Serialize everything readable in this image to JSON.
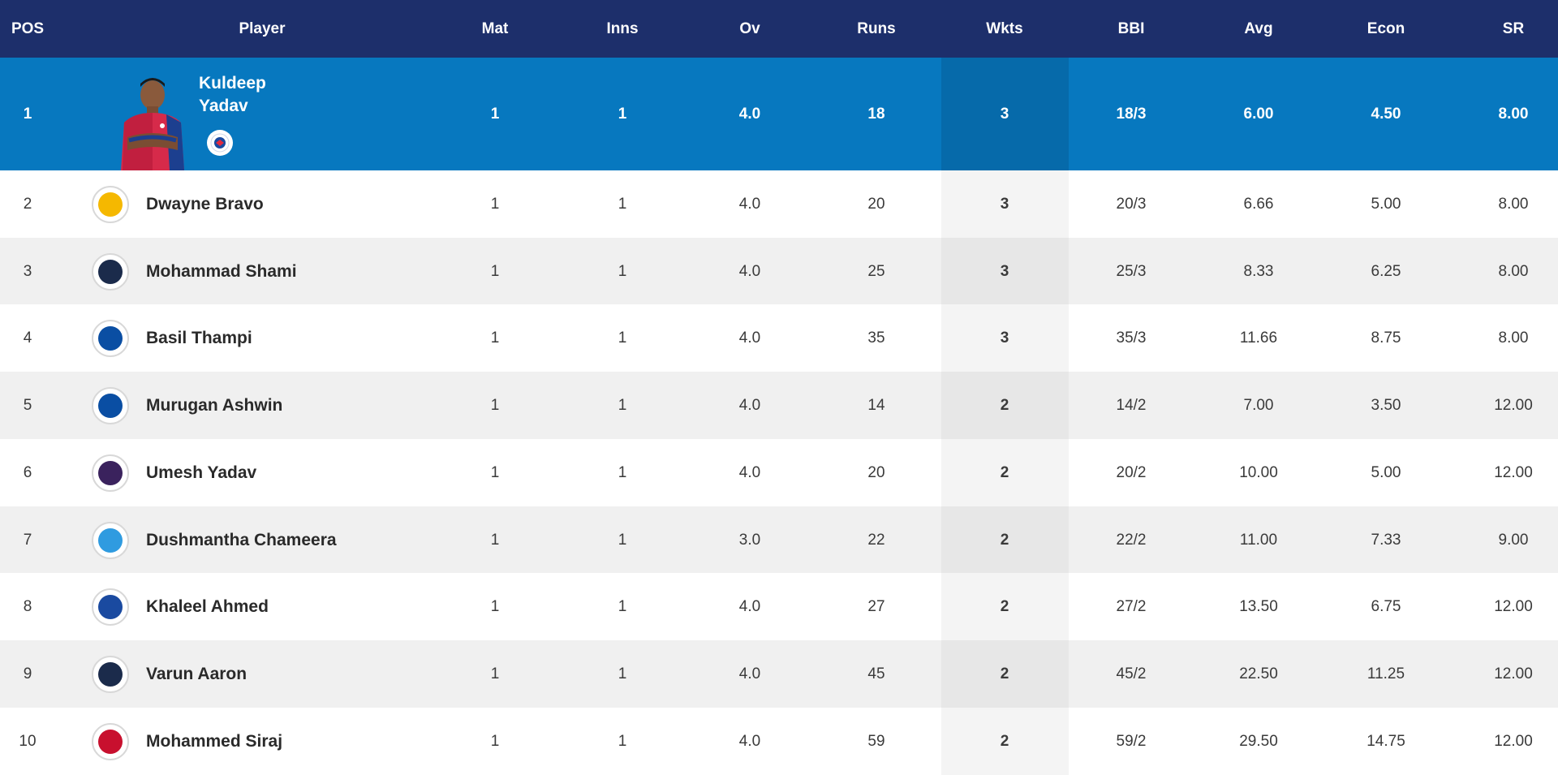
{
  "headers": {
    "pos": "POS",
    "player": "Player",
    "mat": "Mat",
    "inns": "Inns",
    "ov": "Ov",
    "runs": "Runs",
    "wkts": "Wkts",
    "bbi": "BBI",
    "avg": "Avg",
    "econ": "Econ",
    "sr": "SR"
  },
  "leader": {
    "pos": "1",
    "name_line1": "Kuldeep",
    "name_line2": "Yadav",
    "team_icon": "delhi-capitals-logo",
    "mat": "1",
    "inns": "1",
    "ov": "4.0",
    "runs": "18",
    "wkts": "3",
    "bbi": "18/3",
    "avg": "6.00",
    "econ": "4.50",
    "sr": "8.00"
  },
  "rows": [
    {
      "pos": "2",
      "name": "Dwayne Bravo",
      "team_icon": "chennai-super-kings-logo",
      "mat": "1",
      "inns": "1",
      "ov": "4.0",
      "runs": "20",
      "wkts": "3",
      "bbi": "20/3",
      "avg": "6.66",
      "econ": "5.00",
      "sr": "8.00"
    },
    {
      "pos": "3",
      "name": "Mohammad Shami",
      "team_icon": "gujarat-titans-logo",
      "mat": "1",
      "inns": "1",
      "ov": "4.0",
      "runs": "25",
      "wkts": "3",
      "bbi": "25/3",
      "avg": "8.33",
      "econ": "6.25",
      "sr": "8.00"
    },
    {
      "pos": "4",
      "name": "Basil Thampi",
      "team_icon": "mumbai-indians-logo",
      "mat": "1",
      "inns": "1",
      "ov": "4.0",
      "runs": "35",
      "wkts": "3",
      "bbi": "35/3",
      "avg": "11.66",
      "econ": "8.75",
      "sr": "8.00"
    },
    {
      "pos": "5",
      "name": "Murugan Ashwin",
      "team_icon": "mumbai-indians-logo",
      "mat": "1",
      "inns": "1",
      "ov": "4.0",
      "runs": "14",
      "wkts": "2",
      "bbi": "14/2",
      "avg": "7.00",
      "econ": "3.50",
      "sr": "12.00"
    },
    {
      "pos": "6",
      "name": "Umesh Yadav",
      "team_icon": "kolkata-knight-riders-logo",
      "mat": "1",
      "inns": "1",
      "ov": "4.0",
      "runs": "20",
      "wkts": "2",
      "bbi": "20/2",
      "avg": "10.00",
      "econ": "5.00",
      "sr": "12.00"
    },
    {
      "pos": "7",
      "name": "Dushmantha Chameera",
      "team_icon": "lucknow-super-giants-logo",
      "mat": "1",
      "inns": "1",
      "ov": "3.0",
      "runs": "22",
      "wkts": "2",
      "bbi": "22/2",
      "avg": "11.00",
      "econ": "7.33",
      "sr": "9.00"
    },
    {
      "pos": "8",
      "name": "Khaleel Ahmed",
      "team_icon": "delhi-capitals-logo",
      "mat": "1",
      "inns": "1",
      "ov": "4.0",
      "runs": "27",
      "wkts": "2",
      "bbi": "27/2",
      "avg": "13.50",
      "econ": "6.75",
      "sr": "12.00"
    },
    {
      "pos": "9",
      "name": "Varun Aaron",
      "team_icon": "gujarat-titans-logo",
      "mat": "1",
      "inns": "1",
      "ov": "4.0",
      "runs": "45",
      "wkts": "2",
      "bbi": "45/2",
      "avg": "22.50",
      "econ": "11.25",
      "sr": "12.00"
    },
    {
      "pos": "10",
      "name": "Mohammed Siraj",
      "team_icon": "royal-challengers-bangalore-logo",
      "mat": "1",
      "inns": "1",
      "ov": "4.0",
      "runs": "59",
      "wkts": "2",
      "bbi": "59/2",
      "avg": "29.50",
      "econ": "14.75",
      "sr": "12.00"
    }
  ],
  "colors": {
    "header_bg": "#1d2f6b",
    "leader_bg": "#0778bf",
    "csk": "#f5b800",
    "gt": "#1b2b4b",
    "mi": "#0a4ea3",
    "kkr": "#3a225d",
    "lsg": "#2f9be0",
    "dc": "#1a4aa0",
    "rcb": "#c8102e"
  }
}
